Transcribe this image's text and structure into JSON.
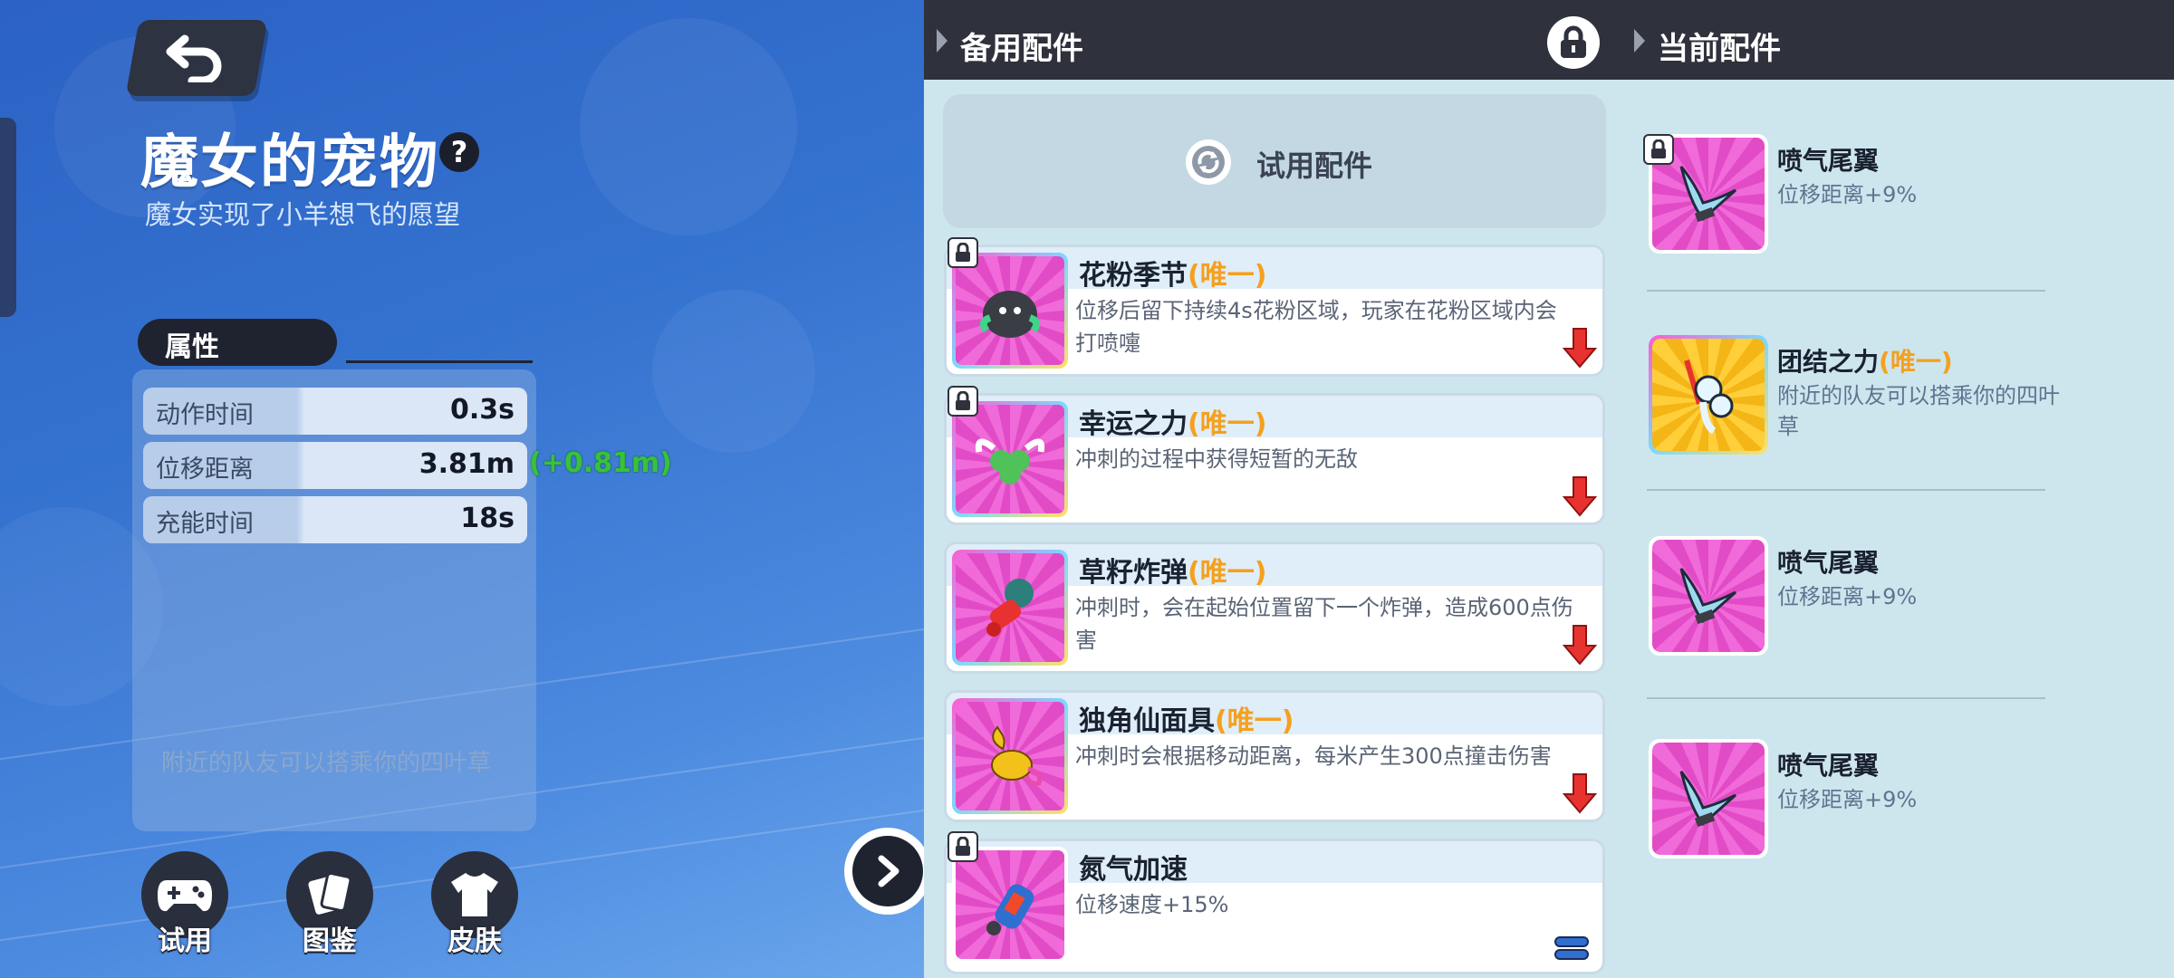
{
  "pet": {
    "title": "魔女的宠物",
    "help": "?",
    "subtitle": "魔女实现了小羊想飞的愿望"
  },
  "attributes": {
    "tab_label": "属性",
    "rows": [
      {
        "label": "动作时间",
        "value": "0.3s"
      },
      {
        "label": "位移距离",
        "value": "3.81m",
        "bonus": "(+0.81m)"
      },
      {
        "label": "充能时间",
        "value": "18s"
      }
    ],
    "description": "附近的队友可以搭乘你的四叶草"
  },
  "bottom_buttons": [
    {
      "label": "试用",
      "icon": "gamepad-icon"
    },
    {
      "label": "图鉴",
      "icon": "cards-icon"
    },
    {
      "label": "皮肤",
      "icon": "shirt-icon"
    }
  ],
  "spare": {
    "header": "备用配件",
    "trial_label": "试用配件",
    "items": [
      {
        "name": "花粉季节",
        "unique": "(唯一)",
        "desc": "位移后留下持续4s花粉区域，玩家在花粉区域内会打喷嚏",
        "locked": true,
        "icon": "spore-creature-icon"
      },
      {
        "name": "幸运之力",
        "unique": "(唯一)",
        "desc": "冲刺的过程中获得短暂的无敌",
        "locked": true,
        "icon": "winged-clover-icon"
      },
      {
        "name": "草籽炸弹",
        "unique": "(唯一)",
        "desc": "冲刺时，会在起始位置留下一个炸弹，造成600点伤害",
        "locked": false,
        "icon": "seed-bomb-icon"
      },
      {
        "name": "独角仙面具",
        "unique": "(唯一)",
        "desc": "冲刺时会根据移动距离，每米产生300点撞击伤害",
        "locked": false,
        "icon": "beetle-mask-icon"
      },
      {
        "name": "氮气加速",
        "unique": "",
        "desc": "位移速度+15%",
        "locked": true,
        "icon": "nitro-bottle-icon"
      }
    ]
  },
  "current": {
    "header": "当前配件",
    "items": [
      {
        "name": "喷气尾翼",
        "unique": "",
        "desc": "位移距离+9%",
        "locked": true,
        "icon": "jet-wing-icon"
      },
      {
        "name": "团结之力",
        "unique": "(唯一)",
        "desc": "附近的队友可以搭乘你的四叶草",
        "locked": false,
        "icon": "team-power-icon"
      },
      {
        "name": "喷气尾翼",
        "unique": "",
        "desc": "位移距离+9%",
        "locked": false,
        "icon": "jet-wing-icon"
      },
      {
        "name": "喷气尾翼",
        "unique": "",
        "desc": "位移距离+9%",
        "locked": false,
        "icon": "jet-wing-icon"
      }
    ]
  },
  "colors": {
    "accent_unique": "#f5a01e",
    "bonus_green": "#38c23b",
    "header_bg": "#2f323c",
    "panel_bg": "#cde6ee",
    "card_pink": "#e24bc6"
  }
}
